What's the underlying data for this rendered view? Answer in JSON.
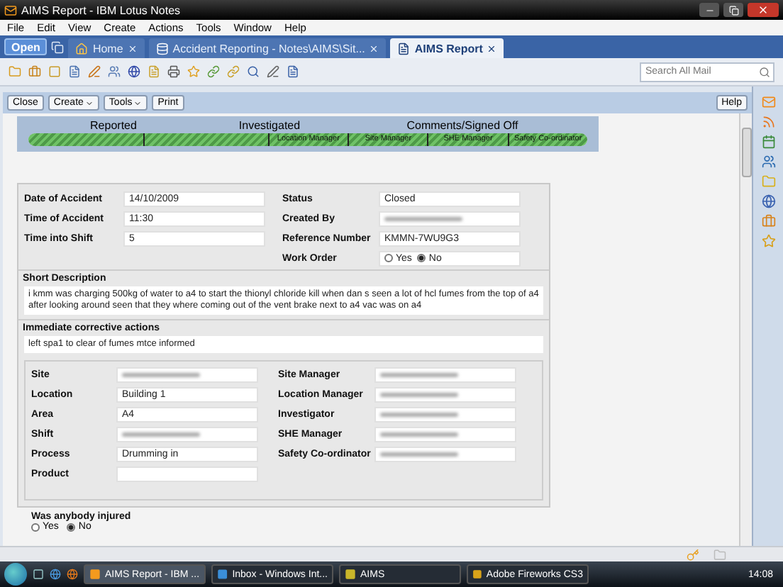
{
  "window": {
    "title": "AIMS Report - IBM Lotus Notes"
  },
  "menu": [
    "File",
    "Edit",
    "View",
    "Create",
    "Actions",
    "Tools",
    "Window",
    "Help"
  ],
  "open_button": "Open",
  "tabs": [
    {
      "label": "Home",
      "kind": "home",
      "selected": false
    },
    {
      "label": "Accident Reporting - Notes\\AIMS\\Sit...",
      "kind": "db",
      "selected": false
    },
    {
      "label": "AIMS Report",
      "kind": "doc",
      "selected": true
    }
  ],
  "search": {
    "placeholder": "Search All Mail"
  },
  "action_buttons": [
    {
      "label": "Close",
      "dropdown": false
    },
    {
      "label": "Create",
      "dropdown": true
    },
    {
      "label": "Tools",
      "dropdown": true
    },
    {
      "label": "Print",
      "dropdown": false
    }
  ],
  "help_button": "Help",
  "workflow": {
    "level": 1,
    "stages": [
      "Reported",
      "Investigated",
      "Comments/Signed Off"
    ],
    "substages": [
      "Location Manager",
      "Site Manager",
      "SHE Manager",
      "Safety Co-ordinator"
    ]
  },
  "header_left": [
    {
      "label": "Date of Accident",
      "value": "14/10/2009"
    },
    {
      "label": "Time of Accident",
      "value": "11:30"
    },
    {
      "label": "Time into Shift",
      "value": "5"
    }
  ],
  "header_right": [
    {
      "label": "Status",
      "value": "Closed"
    },
    {
      "label": "Created By",
      "redacted": true
    },
    {
      "label": "Reference Number",
      "value": "KMMN-7WU9G3"
    },
    {
      "label": "Work Order",
      "options": [
        {
          "label": "Yes",
          "selected": false
        },
        {
          "label": "No",
          "selected": true
        }
      ]
    }
  ],
  "short_description": {
    "label": "Short Description",
    "text": "i kmm was charging 500kg of water to a4 to start the thionyl chloride kill when dan s seen a lot of hcl fumes from the top of a4 after looking around seen that they where coming out of the vent brake next to a4 vac was on a4"
  },
  "corrective_actions": {
    "label": "Immediate corrective actions",
    "text": "left spa1 to clear of fumes mtce informed"
  },
  "details_left": [
    {
      "label": "Site",
      "redacted": true
    },
    {
      "label": "Location",
      "value": "Building 1"
    },
    {
      "label": "Area",
      "value": "A4"
    },
    {
      "label": "Shift",
      "redacted": true
    },
    {
      "label": "Process",
      "value": "Drumming in"
    },
    {
      "label": "Product"
    }
  ],
  "details_right": [
    {
      "label": "Site Manager",
      "redacted": true
    },
    {
      "label": "Location Manager",
      "redacted": true
    },
    {
      "label": "Investigator",
      "redacted": true
    },
    {
      "label": "SHE Manager",
      "redacted": true
    },
    {
      "label": "Safety Co-ordinator",
      "redacted": true
    }
  ],
  "injured": {
    "label": "Was anybody injured",
    "options": [
      {
        "label": "Yes",
        "selected": false
      },
      {
        "label": "No",
        "selected": true
      }
    ]
  },
  "taskbar": {
    "items": [
      {
        "label": "AIMS Report - IBM ...",
        "kind": "notes",
        "selected": true
      },
      {
        "label": "Inbox - Windows Int...",
        "kind": "ie",
        "selected": false
      },
      {
        "label": "AIMS",
        "kind": "app",
        "selected": false
      },
      {
        "label": "Adobe Fireworks CS3",
        "kind": "fw",
        "selected": false
      }
    ],
    "clock": "14:08"
  }
}
